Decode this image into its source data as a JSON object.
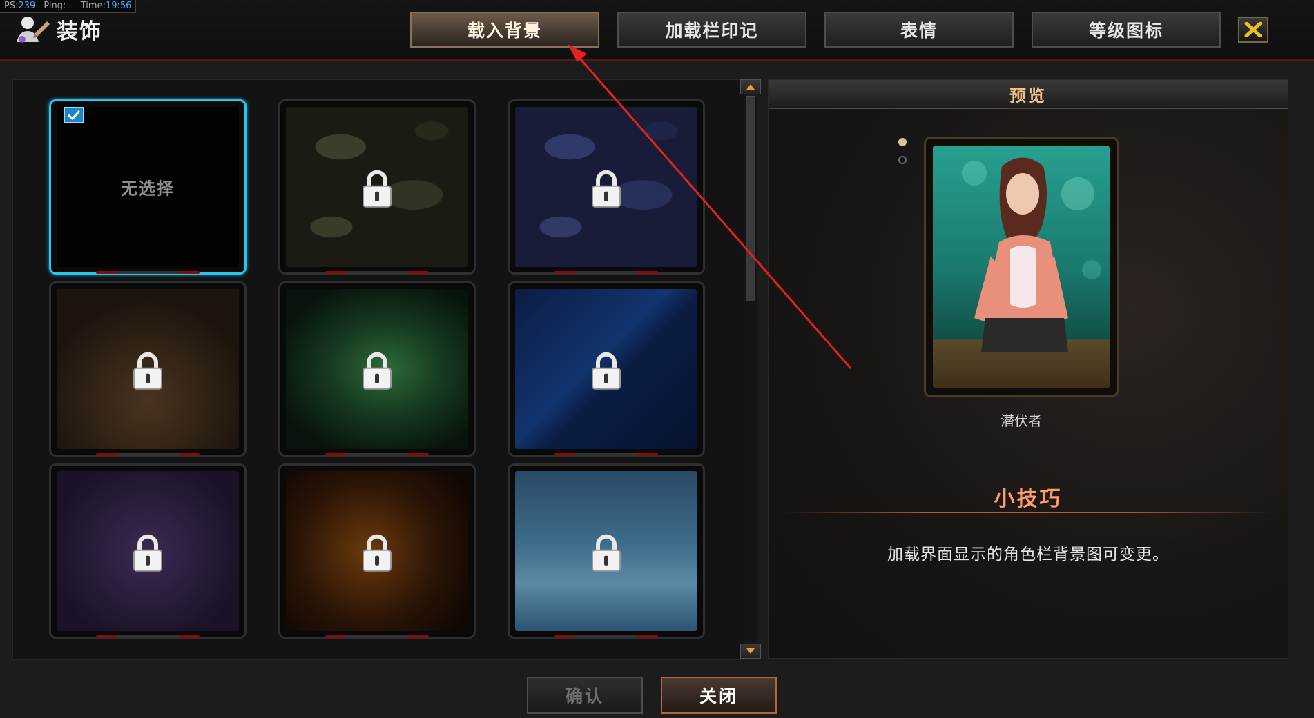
{
  "stats": {
    "fps_label": "PS:",
    "fps_value": "239",
    "ping_label": "Ping:",
    "ping_value": "--",
    "time_label": "Time:",
    "time_value": "19:56"
  },
  "header": {
    "title": "装饰",
    "tabs": [
      "载入背景",
      "加载栏印记",
      "表情",
      "等级图标"
    ],
    "active_tab": 0,
    "close_icon": "close-x-icon"
  },
  "grid": {
    "cards": [
      {
        "id": "none",
        "label": "无选择",
        "bg": "none",
        "locked": false,
        "selected": true
      },
      {
        "id": "camo-green",
        "bg": "camo-green",
        "locked": true,
        "selected": false
      },
      {
        "id": "camo-blue",
        "bg": "camo-blue",
        "locked": true,
        "selected": false
      },
      {
        "id": "brown-bokeh",
        "bg": "brown",
        "locked": true,
        "selected": false
      },
      {
        "id": "green-space",
        "bg": "green-space",
        "locked": true,
        "selected": false
      },
      {
        "id": "blue-rays",
        "bg": "blue-rays",
        "locked": true,
        "selected": false
      },
      {
        "id": "purple-stars",
        "bg": "purple",
        "locked": true,
        "selected": false
      },
      {
        "id": "fire-sparks",
        "bg": "fire",
        "locked": true,
        "selected": false
      },
      {
        "id": "ice-water",
        "bg": "ice",
        "locked": true,
        "selected": false
      }
    ]
  },
  "preview": {
    "title": "预览",
    "character_name": "潜伏者",
    "tip_title": "小技巧",
    "tip_text": "加载界面显示的角色栏背景图可变更。"
  },
  "buttons": {
    "confirm": "确认",
    "close": "关闭"
  },
  "colors": {
    "accent_select": "#2cc4ee",
    "tip_title": "#ff9a6a",
    "preview_title": "#f2c488",
    "annotation_arrow": "#e0241c"
  }
}
